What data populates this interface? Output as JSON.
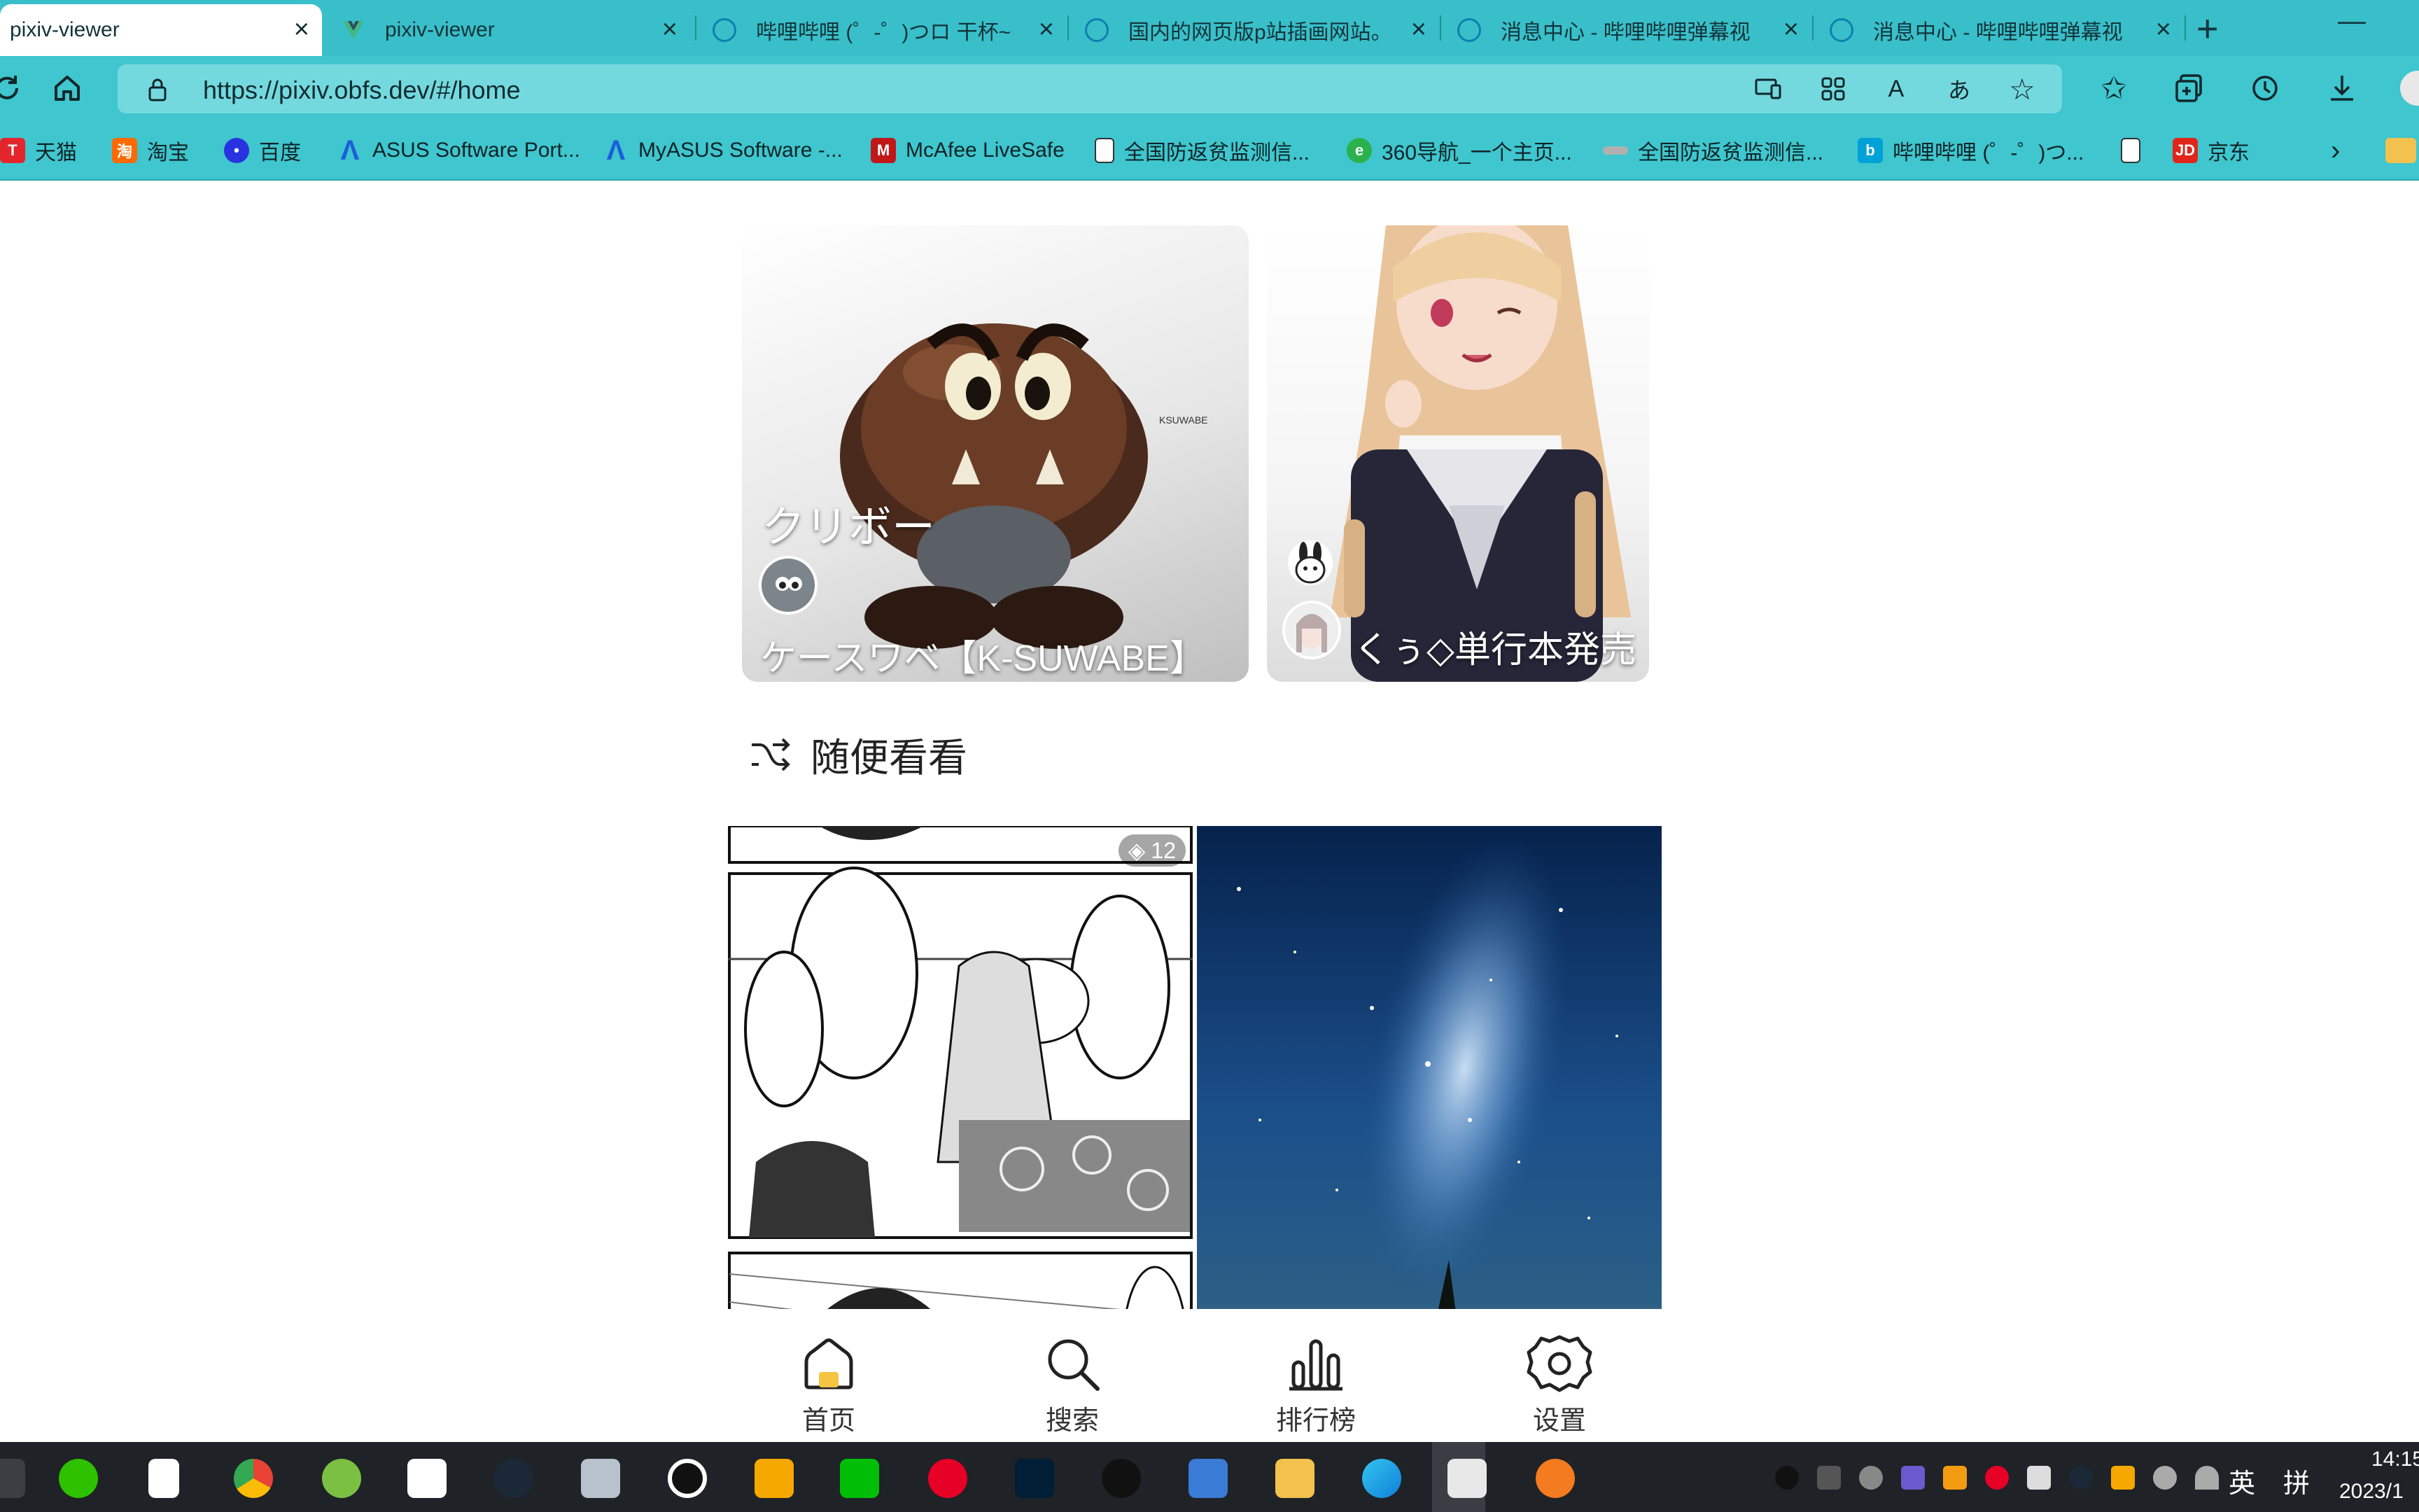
{
  "browser": {
    "tabs": [
      {
        "title": "pixiv-viewer",
        "active": true
      },
      {
        "title": "pixiv-viewer",
        "active": false
      },
      {
        "title": "哔哩哔哩 (゜-゜)つロ 干杯~",
        "active": false
      },
      {
        "title": "国内的网页版p站插画网站。",
        "active": false
      },
      {
        "title": "消息中心 - 哔哩哔哩弹幕视",
        "active": false
      },
      {
        "title": "消息中心 - 哔哩哔哩弹幕视",
        "active": false
      }
    ],
    "new_tab": "+",
    "minimize": "—",
    "url": "https://pixiv.obfs.dev/#/home",
    "bookmarks": [
      {
        "label": "天猫",
        "icon": "tmall-icon",
        "color": "#e3262b"
      },
      {
        "label": "淘宝",
        "icon": "taobao-icon",
        "color": "#ff6a00"
      },
      {
        "label": "百度",
        "icon": "baidu-icon",
        "color": "#2932e1"
      },
      {
        "label": "ASUS Software Port...",
        "icon": "asus-icon",
        "color": "#1b5fd9"
      },
      {
        "label": "MyASUS Software -...",
        "icon": "asus-icon",
        "color": "#1b5fd9"
      },
      {
        "label": "McAfee LiveSafe",
        "icon": "mcafee-icon",
        "color": "#c01818"
      },
      {
        "label": "全国防返贫监测信...",
        "icon": "page-icon",
        "color": "#ffffff"
      },
      {
        "label": "360导航_一个主页...",
        "icon": "360-icon",
        "color": "#2bb24c"
      },
      {
        "label": "全国防返贫监测信...",
        "icon": "link-icon",
        "color": "#8a8a8a"
      },
      {
        "label": "哔哩哔哩 (゜-゜)つ...",
        "icon": "bilibili-icon",
        "color": "#00a1d6"
      },
      {
        "label": "",
        "icon": "page-icon",
        "color": "#ffffff"
      },
      {
        "label": "京东",
        "icon": "jd-icon",
        "color": "#e1251b"
      }
    ]
  },
  "feature_cards": [
    {
      "title": "クリボー",
      "author": "ケースワベ【K-SUWABE】",
      "image_label": "KSUWABE"
    },
    {
      "title": "",
      "author": "くぅ◇単行本発売"
    }
  ],
  "section": {
    "title": "随便看看",
    "icon": "shuffle-icon"
  },
  "tiles": [
    {
      "kind": "manga",
      "page_count": "12"
    },
    {
      "kind": "starry-sky"
    }
  ],
  "app_nav": [
    {
      "label": "首页",
      "icon": "home-icon"
    },
    {
      "label": "搜索",
      "icon": "search-icon"
    },
    {
      "label": "排行榜",
      "icon": "ranking-icon"
    },
    {
      "label": "设置",
      "icon": "gear-icon"
    }
  ],
  "taskbar": {
    "ime_lang": "英",
    "ime_mode": "拼",
    "time": "14:15",
    "date": "2023/1"
  },
  "colors": {
    "tab_bar": "#39bfc9",
    "toolbar": "#3fc6ce",
    "omnibox": "#74d9de",
    "taskbar": "#1f2226"
  }
}
